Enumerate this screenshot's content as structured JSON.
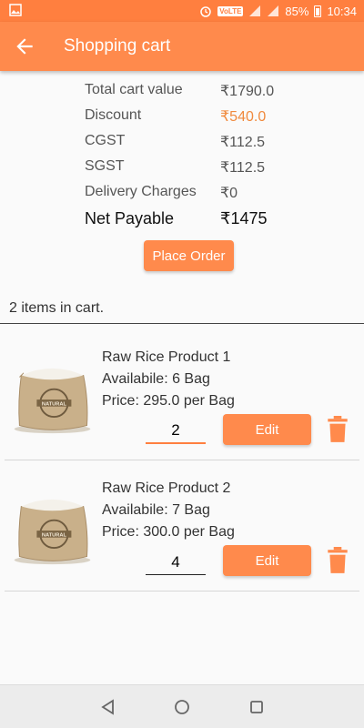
{
  "status_bar": {
    "volte": "VoLTE",
    "battery": "85%",
    "time": "10:34",
    "icons": [
      "image-icon",
      "alarm-icon",
      "signal-icon",
      "signal-icon-2",
      "battery-icon"
    ]
  },
  "app_bar": {
    "title": "Shopping cart",
    "back_icon": "arrow-back-icon"
  },
  "summary": {
    "rows": [
      {
        "label": "Total cart value",
        "value": "₹1790.0"
      },
      {
        "label": "Discount",
        "value": "₹540.0"
      },
      {
        "label": "CGST",
        "value": "₹112.5"
      },
      {
        "label": "SGST",
        "value": "₹112.5"
      },
      {
        "label": "Delivery Charges",
        "value": "₹0"
      }
    ],
    "net": {
      "label": "Net Payable",
      "value": "₹1475"
    }
  },
  "place_order_label": "Place Order",
  "items_count": "2 items in cart.",
  "items": [
    {
      "name": "Raw Rice Product 1",
      "availability": "Availabile: 6 Bag",
      "price": "Price: 295.0 per Bag",
      "quantity": "2",
      "edit_label": "Edit"
    },
    {
      "name": "Raw Rice Product 2",
      "availability": "Availabile: 7 Bag",
      "price": "Price: 300.0 per Bag",
      "quantity": "4",
      "edit_label": "Edit"
    }
  ],
  "colors": {
    "accent": "#ff8a4c",
    "status_bar": "#ff7f3f",
    "discount": "#f08a3e"
  }
}
